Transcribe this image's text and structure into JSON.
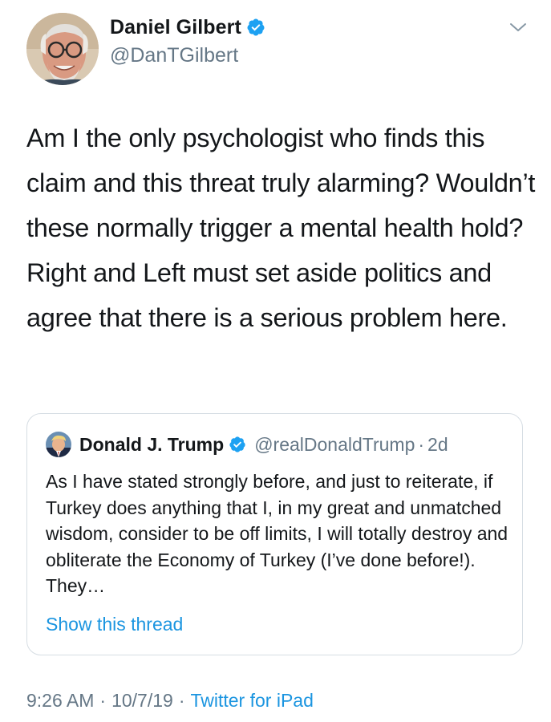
{
  "author": {
    "display_name": "Daniel Gilbert",
    "handle": "@DanTGilbert",
    "verified": true,
    "avatar_icon": "avatar-photo-man-glasses"
  },
  "tweet": {
    "text": "Am I the only psychologist who finds this claim and this threat truly alarming? Wouldn’t these normally trigger a mental health hold? Right and Left must set aside politics and agree that there is a serious problem here."
  },
  "quoted_tweet": {
    "display_name": "Donald J. Trump",
    "handle": "@realDonaldTrump",
    "separator": "·",
    "time": "2d",
    "verified": true,
    "text": "As I have stated strongly before, and just to reiterate, if Turkey does anything that I, in my great and unmatched wisdom, consider to be off limits, I will totally destroy and obliterate the Economy of Turkey (I’ve done before!). They…",
    "show_thread_label": "Show this thread"
  },
  "footer": {
    "time": "9:26 AM",
    "separator": "·",
    "date": "10/7/19",
    "source": "Twitter for iPad"
  },
  "colors": {
    "text": "#14171a",
    "secondary": "#657786",
    "link": "#1b95e0",
    "verified": "#1da1f2",
    "border": "#d6dde3"
  },
  "icons": {
    "verified": "verified-badge-icon",
    "caret": "chevron-down-icon"
  }
}
